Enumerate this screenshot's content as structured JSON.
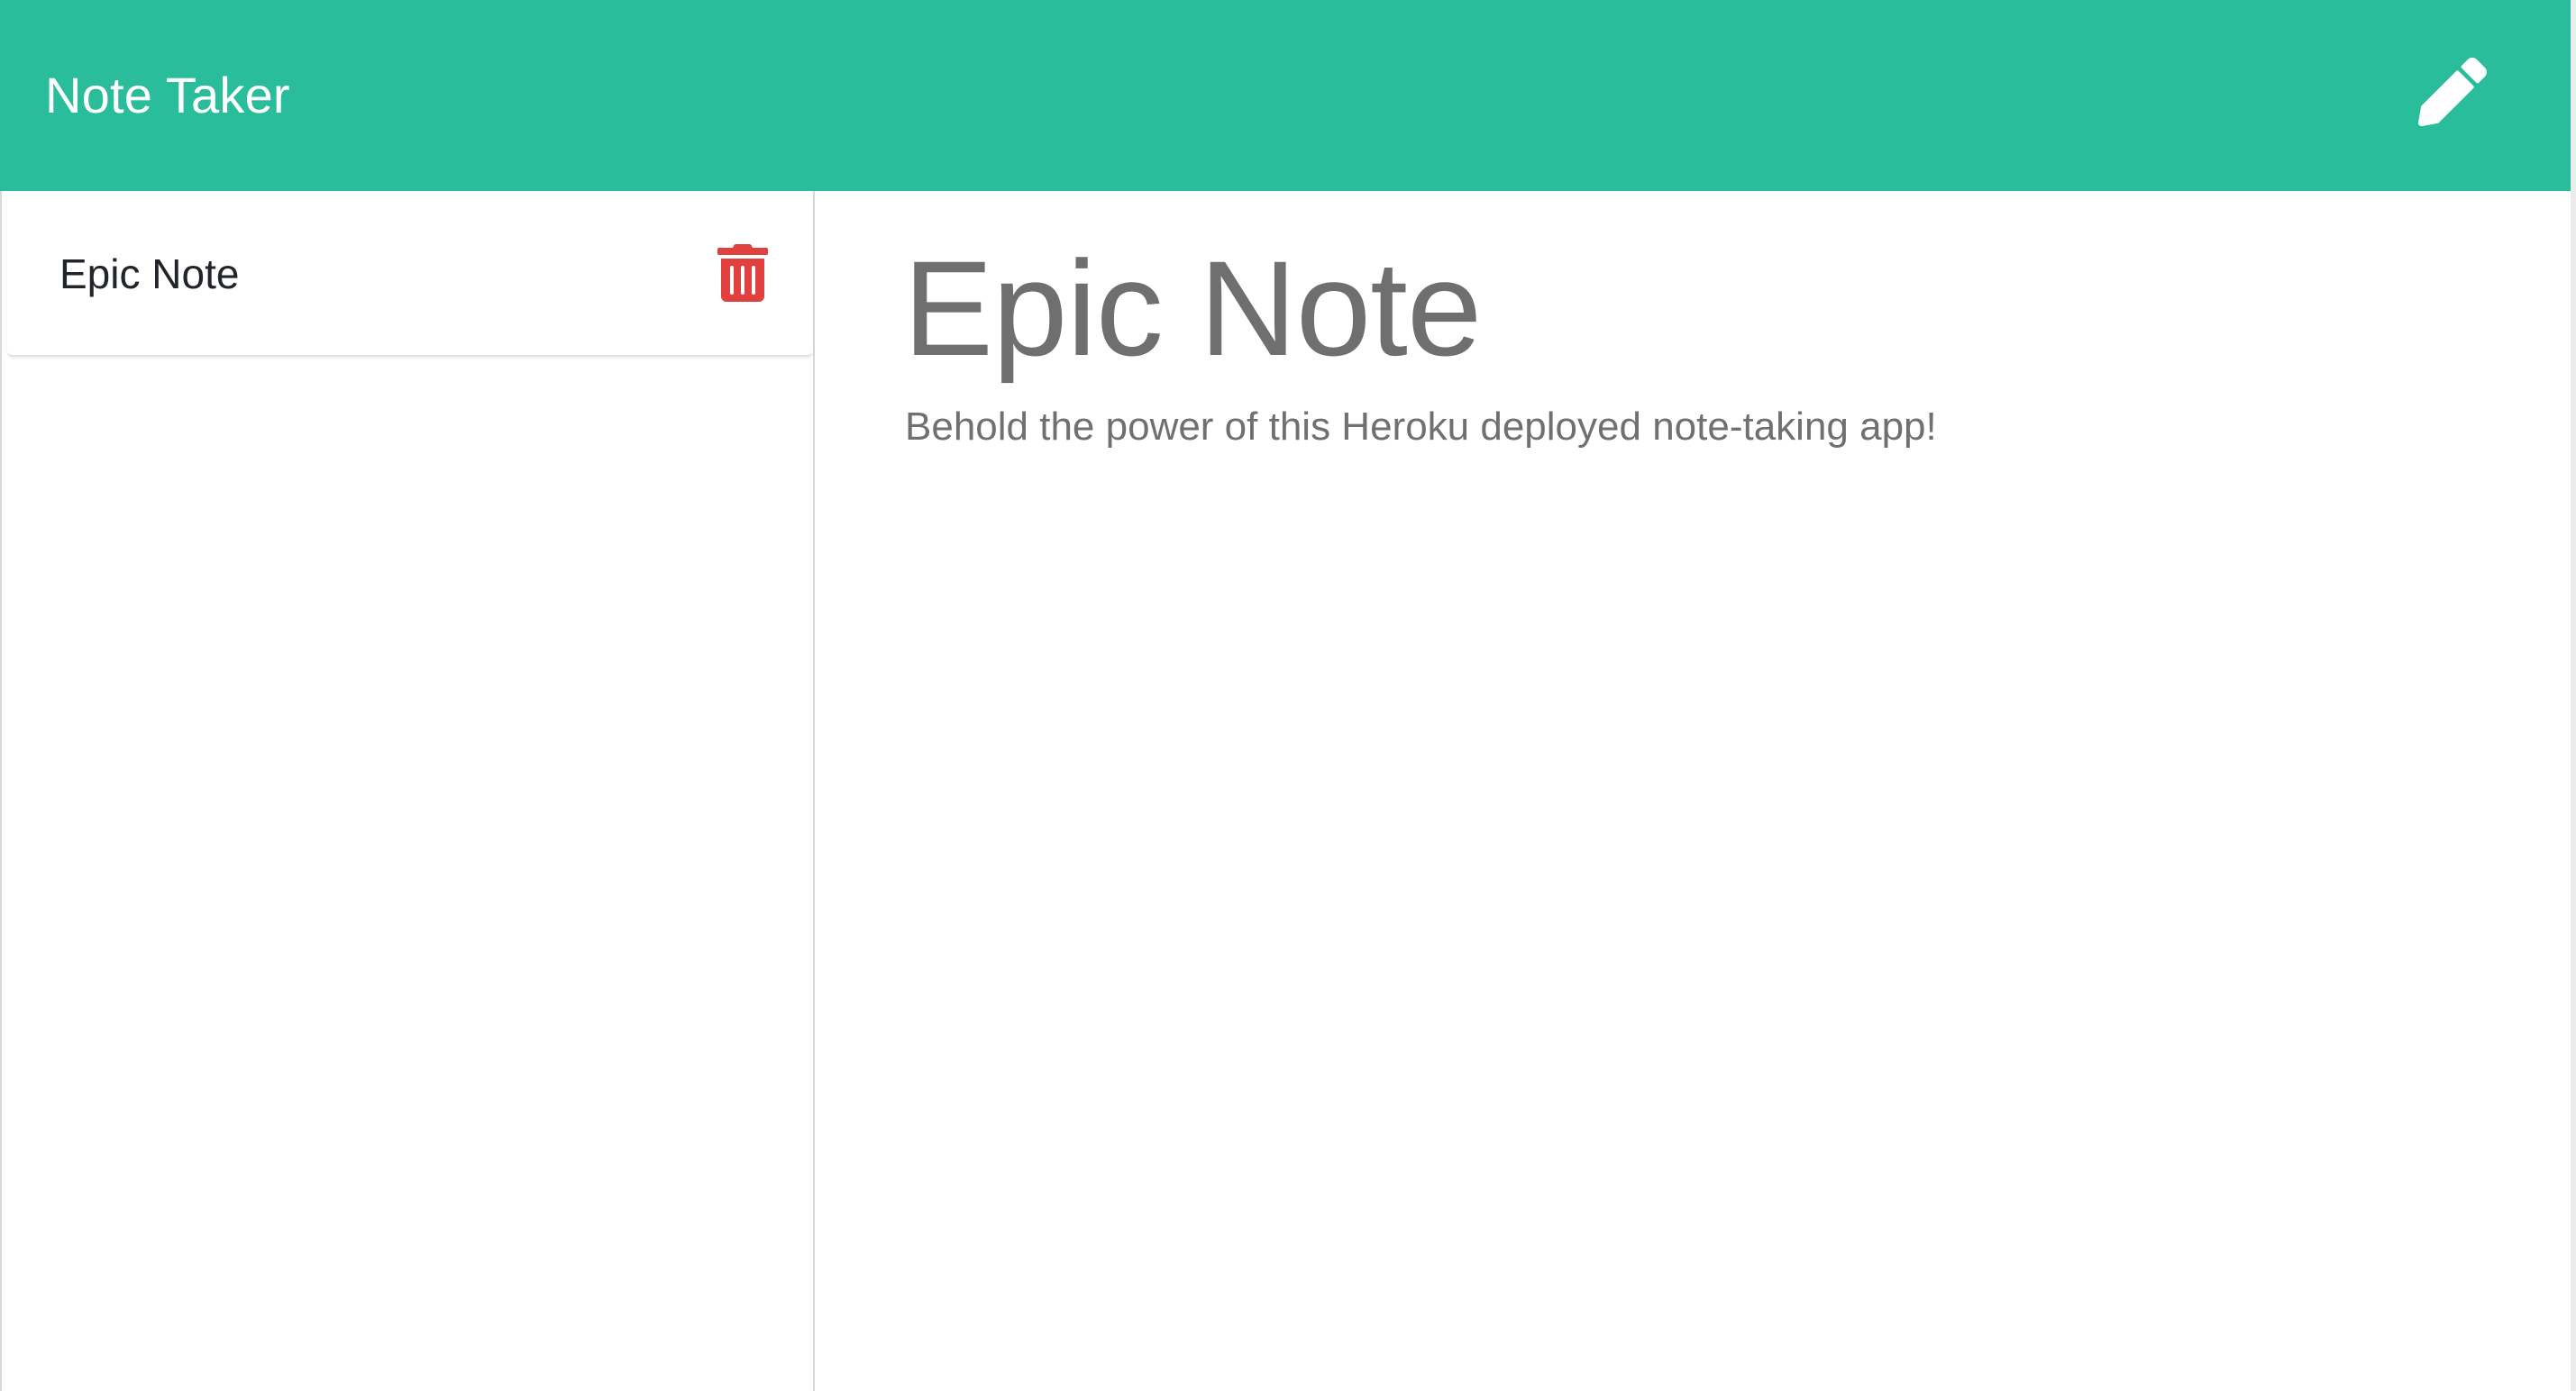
{
  "app": {
    "title": "Note Taker",
    "accent_color": "#2abd9b",
    "delete_color": "#e0413f"
  },
  "navbar": {
    "new_note_icon": "pencil-icon"
  },
  "sidebar": {
    "notes": [
      {
        "title": "Epic Note",
        "delete_icon": "trash-icon"
      }
    ]
  },
  "editor": {
    "title": "Epic Note",
    "text": "Behold the power of this Heroku deployed note-taking app!"
  }
}
